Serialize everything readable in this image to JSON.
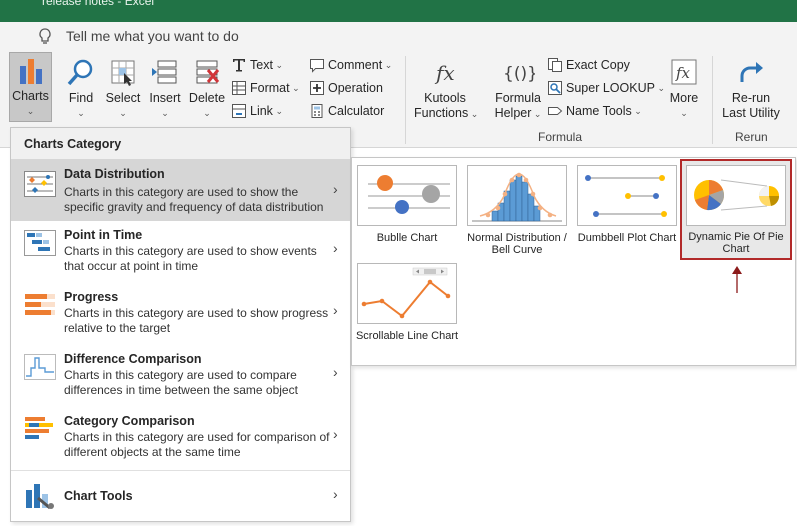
{
  "window": {
    "title": "release notes  -  Excel"
  },
  "tell_me": {
    "text": "Tell me what you want to do"
  },
  "ribbon": {
    "charts": "Charts",
    "find": "Find",
    "select": "Select",
    "insert": "Insert",
    "delete": "Delete",
    "text": "Text",
    "format": "Format",
    "link": "Link",
    "comment": "Comment",
    "operation": "Operation",
    "calculator": "Calculator",
    "kutools_functions_1": "Kutools",
    "kutools_functions_2": "Functions",
    "formula_helper_1": "Formula",
    "formula_helper_2": "Helper",
    "exact_copy": "Exact Copy",
    "super_lookup": "Super LOOKUP",
    "name_tools": "Name Tools",
    "more": "More",
    "rerun_1": "Re-run",
    "rerun_2": "Last Utility",
    "group_formula": "Formula",
    "group_rerun": "Rerun"
  },
  "menu": {
    "header": "Charts Category",
    "items": [
      {
        "title": "Data Distribution",
        "desc": "Charts in this category are used to show the specific gravity and frequency of data distribution"
      },
      {
        "title": "Point in Time",
        "desc": "Charts in this category are used to show events that occur at point in time"
      },
      {
        "title": "Progress",
        "desc": "Charts in this category are used to show progress relative to the target"
      },
      {
        "title": "Difference Comparison",
        "desc": "Charts in this category are used to compare differences in time between the same object"
      },
      {
        "title": "Category Comparison",
        "desc": "Charts in this category are used for comparison of different objects at the same time"
      },
      {
        "title": "Chart Tools",
        "desc": ""
      }
    ]
  },
  "panel": {
    "tiles": [
      {
        "label": "Bublle Chart"
      },
      {
        "label": "Normal Distribution / Bell Curve"
      },
      {
        "label": "Dumbbell Plot Chart"
      },
      {
        "label": "Dynamic Pie Of Pie Chart"
      },
      {
        "label": "Scrollable Line Chart"
      }
    ]
  },
  "colors": {
    "title_bar": "#217346",
    "highlight": "#b22a2a",
    "orange": "#ed7d31",
    "blue": "#4472c4",
    "gold": "#ffc000"
  }
}
